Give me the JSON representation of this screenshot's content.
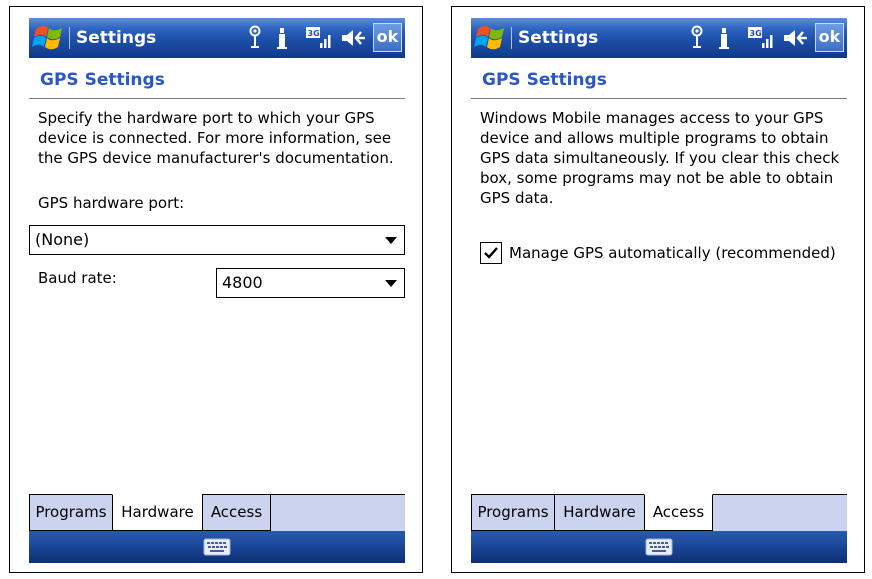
{
  "screens": [
    {
      "title": "Settings",
      "ok_label": "ok",
      "header": "GPS Settings",
      "description": "Specify the hardware port to which your GPS device is connected. For more information, see the GPS device manufacturer's documentation.",
      "port_label": "GPS hardware port:",
      "port_value": "(None)",
      "baud_label": "Baud rate:",
      "baud_value": "4800",
      "tabs": [
        "Programs",
        "Hardware",
        "Access"
      ],
      "active_tab": "Hardware"
    },
    {
      "title": "Settings",
      "ok_label": "ok",
      "header": "GPS Settings",
      "description": "Windows Mobile manages access to your GPS device and allows multiple programs to obtain GPS data simultaneously. If you clear this check box, some programs may not be able to obtain GPS data.",
      "checkbox_label": "Manage GPS automatically (recommended)",
      "checkbox_checked": true,
      "tabs": [
        "Programs",
        "Hardware",
        "Access"
      ],
      "active_tab": "Access"
    }
  ],
  "icons": {
    "start": "windows-flag-icon",
    "signal": "antenna-icon",
    "connectivity": "connection-icon",
    "network": "3g-signal-icon",
    "volume": "speaker-icon",
    "keyboard": "keyboard-icon"
  },
  "colors": {
    "titlebar": "#2c62c0",
    "header_text": "#2a57c4",
    "tabbar": "#cbd3ef",
    "softbar": "#1d4a9c"
  }
}
